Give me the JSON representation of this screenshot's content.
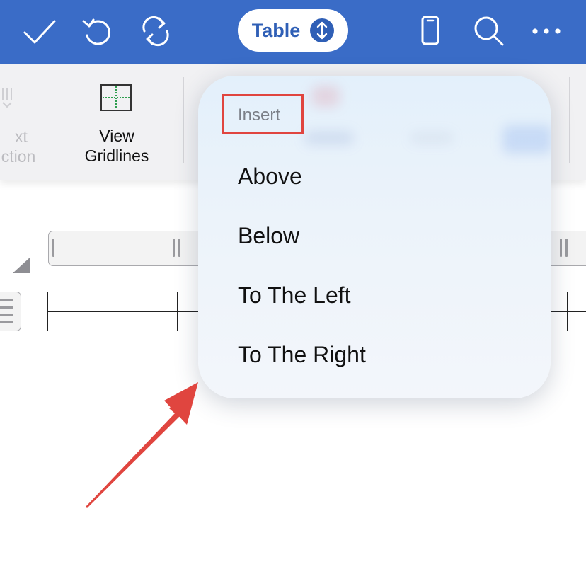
{
  "topbar": {
    "mode_label": "Table",
    "icons": [
      "done-check-icon",
      "undo-icon",
      "sync-icon",
      "phone-view-icon",
      "search-icon",
      "more-icon"
    ],
    "colors": {
      "bar": "#3a6cc7",
      "pill_text": "#2f5fb6"
    }
  },
  "ribbon": {
    "text_selection": {
      "line1": "xt",
      "line2": "ction"
    },
    "view_gridlines": {
      "line1": "View",
      "line2": "Gridlines"
    }
  },
  "popover": {
    "header": "Insert",
    "items": [
      "Above",
      "Below",
      "To The Left",
      "To The Right"
    ]
  },
  "annotation": {
    "color": "#e0453f"
  }
}
